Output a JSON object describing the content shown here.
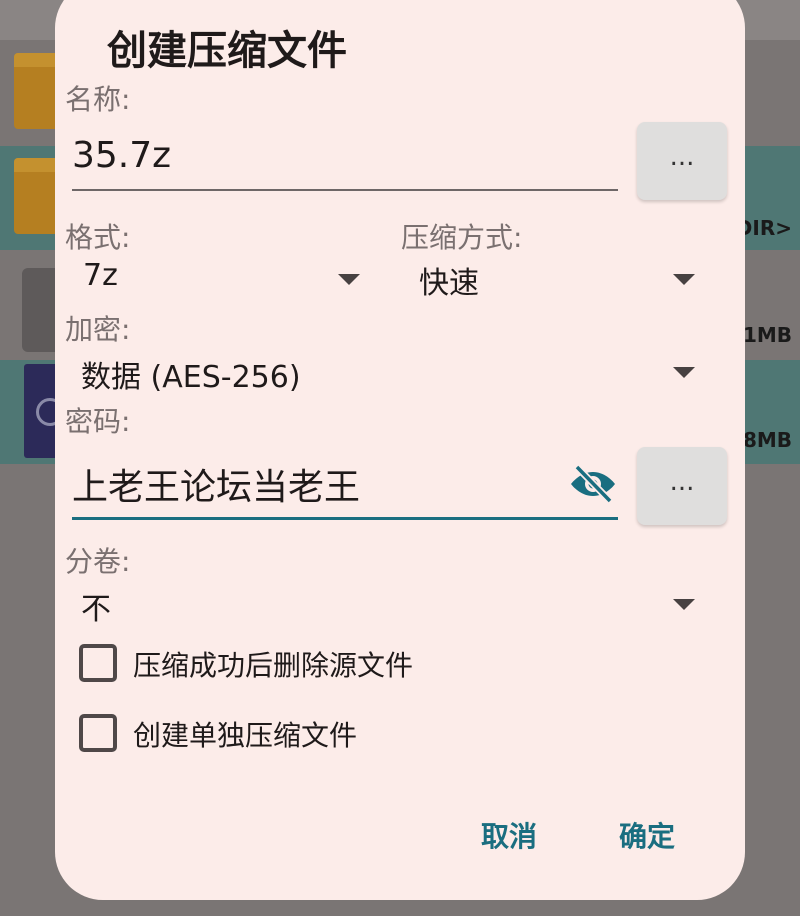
{
  "background": {
    "rows": [
      {
        "meta": ""
      },
      {
        "meta": "DIR>"
      },
      {
        "meta": "1MB"
      },
      {
        "meta": "8MB"
      }
    ]
  },
  "dialog": {
    "title": "创建压缩文件",
    "name_label": "名称:",
    "name_value": "35.7z",
    "more_label": "...",
    "format_label": "格式:",
    "format_value": "7z",
    "compression_label": "压缩方式:",
    "compression_value": "快速",
    "encryption_label": "加密:",
    "encryption_value": "数据 (AES-256)",
    "password_label": "密码:",
    "password_value": "上老王论坛当老王",
    "split_label": "分卷:",
    "split_value": "不",
    "checkbox_delete_source": {
      "label": "压缩成功后删除源文件",
      "checked": false
    },
    "checkbox_separate_archives": {
      "label": "创建单独压缩文件",
      "checked": false
    },
    "cancel_label": "取消",
    "ok_label": "确定",
    "accent_color": "#1a6e80"
  }
}
